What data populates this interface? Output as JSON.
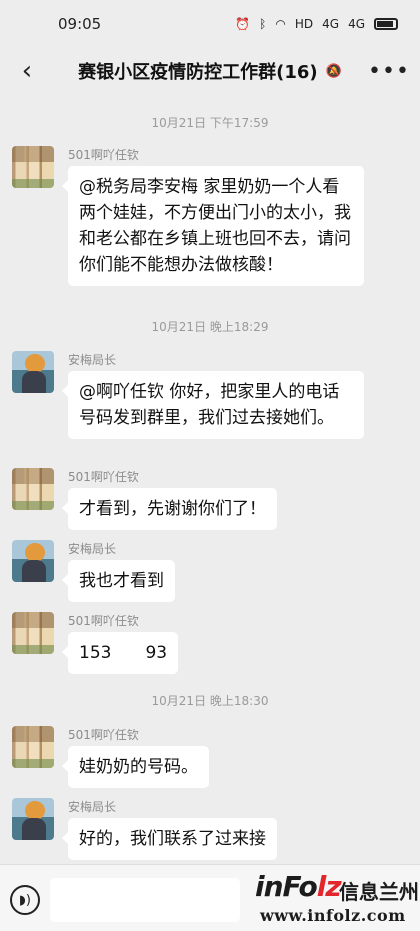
{
  "status_bar": {
    "time": "09:05",
    "network": "HD",
    "signal1": "4G",
    "signal2": "4G"
  },
  "header": {
    "title": "赛银小区疫情防控工作群(16)",
    "back_icon": "chevron-left-icon",
    "mute_icon": "mute-bell-icon",
    "more_icon": "more-dots-icon"
  },
  "messages": [
    {
      "type": "time",
      "text": "10月21日 下午17:59"
    },
    {
      "type": "msg",
      "sender": "501啊吖任钦",
      "avatar": "cartoon-figures-avatar",
      "text": "@税务局李安梅  家里奶奶一个人看两个娃娃，不方便出门小的太小，我和老公都在乡镇上班也回不去，请问你们能不能想办法做核酸！"
    },
    {
      "type": "time",
      "text": "10月21日 晚上18:29"
    },
    {
      "type": "msg",
      "sender": "安梅局长",
      "avatar": "cartoon-person-avatar",
      "text": "@啊吖任钦  你好，把家里人的电话号码发到群里，我们过去接她们。"
    },
    {
      "type": "msg",
      "sender": "501啊吖任钦",
      "avatar": "cartoon-figures-avatar",
      "text": "才看到，先谢谢你们了！"
    },
    {
      "type": "msg",
      "sender": "安梅局长",
      "avatar": "cartoon-person-avatar",
      "text": "我也才看到"
    },
    {
      "type": "msg",
      "sender": "501啊吖任钦",
      "avatar": "cartoon-figures-avatar",
      "text": "153    93"
    },
    {
      "type": "time",
      "text": "10月21日 晚上18:30"
    },
    {
      "type": "msg",
      "sender": "501啊吖任钦",
      "avatar": "cartoon-figures-avatar",
      "text": "娃奶奶的号码。"
    },
    {
      "type": "msg",
      "sender": "安梅局长",
      "avatar": "cartoon-person-avatar",
      "text": "好的，我们联系了过来接"
    }
  ],
  "input_bar": {
    "voice_icon": "voice-icon",
    "placeholder": ""
  },
  "watermark": {
    "logo": "inFolz",
    "name": "信息兰州",
    "url": "www.infolz.com"
  },
  "colors": {
    "background": "#ededed",
    "bubble": "#ffffff",
    "time_text": "#9a9a9a",
    "sender_text": "#8c8c8c",
    "logo_accent": "#e3262b"
  }
}
